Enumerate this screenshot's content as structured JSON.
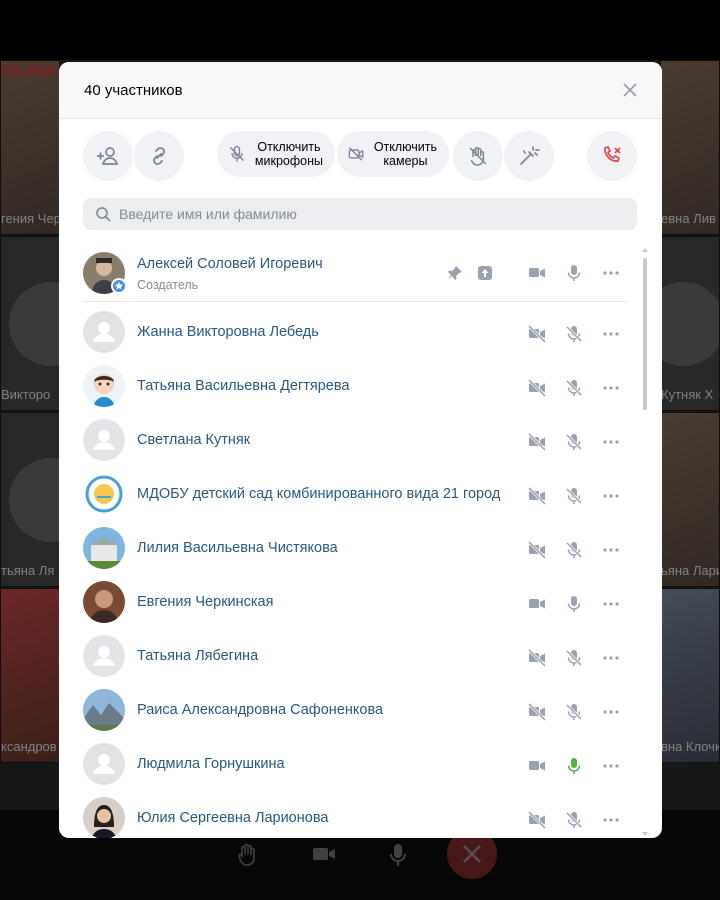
{
  "background": {
    "banner_text": "РАЗВИ",
    "tiles": [
      {
        "name": "гения Чер"
      },
      {
        "name": "Викторо"
      },
      {
        "name": "тьяна Ля"
      },
      {
        "name": "ксандров"
      },
      {
        "name": "евна Лив"
      },
      {
        "name": "Кутняк Х"
      },
      {
        "name": "ьяна Ларио"
      },
      {
        "name": "вна Клочк"
      }
    ]
  },
  "modal": {
    "title": "40 участников",
    "actions": {
      "mute_mics_label": "Отключить\nмикрофоны",
      "mute_cams_label": "Отключить\nкамеры"
    },
    "search": {
      "placeholder": "Введите имя или фамилию",
      "value": ""
    },
    "participants": [
      {
        "name": "Алексей Соловей Игоревич",
        "role": "Создатель",
        "camera": "on",
        "mic": "on",
        "avatar": "photo-man"
      },
      {
        "name": "Жанна Викторовна Лебедь",
        "camera": "off",
        "mic": "off",
        "avatar": "blank"
      },
      {
        "name": "Татьяна Васильевна Дегтярева",
        "camera": "off",
        "mic": "off",
        "avatar": "cartoon"
      },
      {
        "name": "Светлана Кутняк",
        "camera": "off",
        "mic": "off",
        "avatar": "blank"
      },
      {
        "name": "МДОБУ детский сад комбинированного вида 21 город",
        "camera": "off",
        "mic": "off",
        "avatar": "logo"
      },
      {
        "name": "Лилия Васильевна Чистякова",
        "camera": "off",
        "mic": "off",
        "avatar": "building"
      },
      {
        "name": "Евгения Черкинская",
        "camera": "on",
        "mic": "on",
        "avatar": "photo-warm"
      },
      {
        "name": "Татьяна Лябегина",
        "camera": "off",
        "mic": "off",
        "avatar": "blank"
      },
      {
        "name": "Раиса Александровна Сафоненкова",
        "camera": "off",
        "mic": "off",
        "avatar": "mountains"
      },
      {
        "name": "Людмила Горнушкина",
        "camera": "on",
        "mic": "active",
        "avatar": "blank"
      },
      {
        "name": "Юлия Сергеевна Ларионова",
        "camera": "off",
        "mic": "off",
        "avatar": "photo-woman"
      }
    ]
  },
  "colors": {
    "accent_link": "#2a5885",
    "end_call": "#e64646",
    "mic_active": "#4bb34b",
    "icon_gray": "#99a2ad"
  }
}
